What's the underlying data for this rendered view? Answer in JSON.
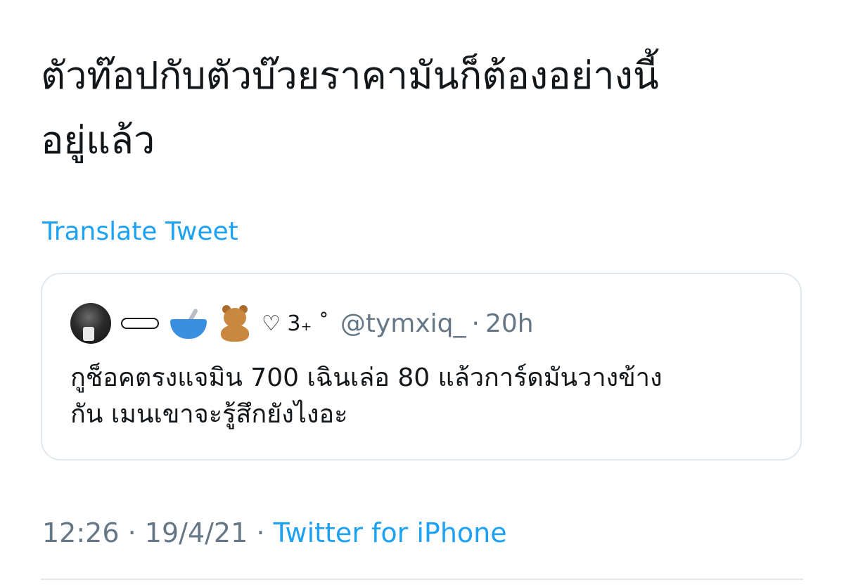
{
  "tweet": {
    "text_line1": "ตัวท๊อปกับตัวบ๊วยราคามันก็ต้องอย่างนี้",
    "text_line2": "อยู่แล้ว",
    "translate_label": "Translate Tweet"
  },
  "quote": {
    "display_name_symbols": "♡ 3₊ ˚",
    "handle": "@tymxiq_",
    "separator": "·",
    "time": "20h",
    "text_line1": "กูช็อคตรงแจมิน 700 เฉินเล่อ 80 แล้วการ์ดมันวางข้าง",
    "text_line2": "กัน เมนเขาจะรู้สึกยังไงอะ"
  },
  "meta": {
    "time": "12:26",
    "sep1": "·",
    "date": "19/4/21",
    "sep2": "·",
    "source": "Twitter for iPhone"
  },
  "colors": {
    "link": "#1da1f2",
    "muted": "#657786",
    "border": "#e1e8ed",
    "text": "#14171a"
  }
}
